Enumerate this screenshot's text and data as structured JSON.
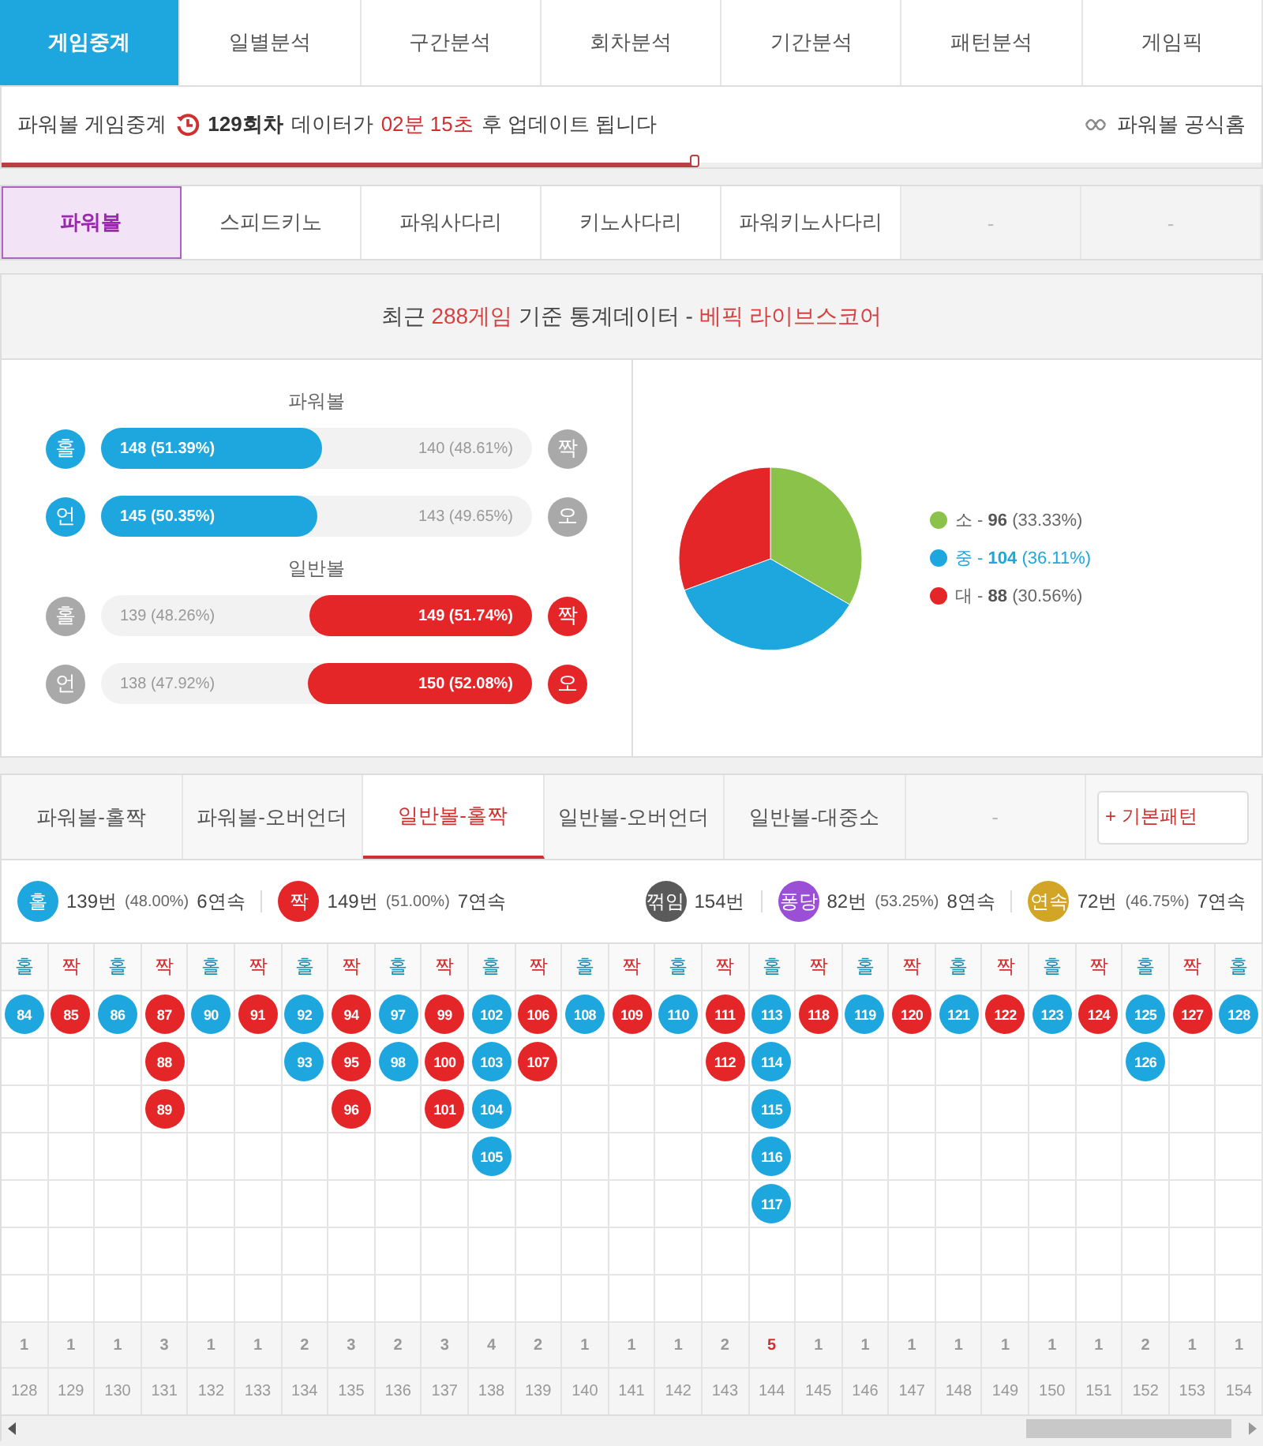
{
  "top_tabs": [
    {
      "label": "게임중계",
      "selected": true
    },
    {
      "label": "일별분석",
      "selected": false
    },
    {
      "label": "구간분석",
      "selected": false
    },
    {
      "label": "회차분석",
      "selected": false
    },
    {
      "label": "기간분석",
      "selected": false
    },
    {
      "label": "패턴분석",
      "selected": false
    },
    {
      "label": "게임픽",
      "selected": false
    }
  ],
  "info_bar": {
    "game": "파워볼 게임중계",
    "round": "129회차",
    "prefix": "데이터가",
    "countdown": "02분 15초",
    "suffix": "후 업데이트 됩니다",
    "progress": {
      "level": 0.55
    },
    "link": "파워볼 공식홈"
  },
  "game_tabs": [
    {
      "label": "파워볼",
      "selected": true,
      "disabled": false
    },
    {
      "label": "스피드키노",
      "selected": false,
      "disabled": false
    },
    {
      "label": "파워사다리",
      "selected": false,
      "disabled": false
    },
    {
      "label": "키노사다리",
      "selected": false,
      "disabled": false
    },
    {
      "label": "파워키노사다리",
      "selected": false,
      "disabled": false
    },
    {
      "label": "-",
      "selected": false,
      "disabled": true
    },
    {
      "label": "-",
      "selected": false,
      "disabled": true
    }
  ],
  "heading": [
    {
      "text": "최근 ",
      "accent": false
    },
    {
      "text": "288게임",
      "accent": true
    },
    {
      "text": " 기준 통계데이터 - ",
      "accent": false
    },
    {
      "text": "베픽 라이브스코어",
      "accent": true
    }
  ],
  "stats": {
    "groups": [
      {
        "title": "파워볼",
        "rows": [
          {
            "left_label": "홀",
            "left_text": "148 (51.39%)",
            "right_text": "140 (48.61%)",
            "right_label": "짝",
            "level": 0.5139
          },
          {
            "left_label": "언",
            "left_text": "145 (50.35%)",
            "right_text": "143 (49.65%)",
            "right_label": "오",
            "level": 0.5035
          }
        ]
      },
      {
        "title": "일반볼",
        "rows": [
          {
            "left_label": "홀",
            "left_text": "139 (48.26%)",
            "right_text": "149 (51.74%)",
            "right_label": "짝",
            "level": 0.4826
          },
          {
            "left_label": "언",
            "left_text": "138 (47.92%)",
            "right_text": "150 (52.08%)",
            "right_label": "오",
            "level": 0.4792
          }
        ]
      }
    ]
  },
  "breakdown": {
    "chart_data": {
      "type": "pie",
      "categories": [
        "소",
        "중",
        "대"
      ],
      "values": [
        33.33,
        36.11,
        30.56
      ]
    },
    "legend": [
      {
        "dash": "-",
        "count": "96",
        "pct": "(33.33%)",
        "color": "#8bc34a",
        "highlight": false
      },
      {
        "dash": "-",
        "count": "104",
        "pct": "(36.11%)",
        "color": "#1ea6de",
        "highlight": true
      },
      {
        "dash": "-",
        "count": "88",
        "pct": "(30.56%)",
        "color": "#e52628",
        "highlight": false
      }
    ]
  },
  "pattern_tabs": [
    {
      "label": "파워볼-홀짝",
      "selected": false,
      "disabled": false
    },
    {
      "label": "파워볼-오버언더",
      "selected": false,
      "disabled": false
    },
    {
      "label": "일반볼-홀짝",
      "selected": true,
      "disabled": false
    },
    {
      "label": "일반볼-오버언더",
      "selected": false,
      "disabled": false
    },
    {
      "label": "일반볼-대중소",
      "selected": false,
      "disabled": false
    },
    {
      "label": "-",
      "selected": false,
      "disabled": true
    }
  ],
  "pattern_button": "+ 기본패턴",
  "summary": {
    "left": [
      {
        "badge": "홀",
        "color": "#1ea6de",
        "count": "139번",
        "pct": "(48.00%)",
        "streak": "6연속"
      },
      {
        "badge": "짝",
        "color": "#e52628",
        "count": "149번",
        "pct": "(51.00%)",
        "streak": "7연속"
      }
    ],
    "right": [
      {
        "badge": "꺾임",
        "color": "#5a5a5a",
        "count": "154번"
      },
      {
        "badge": "퐁당",
        "color": "#9b4fd6",
        "count": "82번",
        "pct": "(53.25%)",
        "streak": "8연속"
      },
      {
        "badge": "연속",
        "color": "#d3a526",
        "count": "72번",
        "pct": "(46.75%)",
        "streak": "7연속"
      }
    ]
  },
  "grid": {
    "columns": [
      {
        "label": "홀",
        "kind": "odd",
        "balls": [
          "84"
        ],
        "count": "1",
        "round": "128",
        "highlight": false
      },
      {
        "label": "짝",
        "kind": "even",
        "balls": [
          "85"
        ],
        "count": "1",
        "round": "129",
        "highlight": false
      },
      {
        "label": "홀",
        "kind": "odd",
        "balls": [
          "86"
        ],
        "count": "1",
        "round": "130",
        "highlight": false
      },
      {
        "label": "짝",
        "kind": "even",
        "balls": [
          "87",
          "88",
          "89"
        ],
        "count": "3",
        "round": "131",
        "highlight": false
      },
      {
        "label": "홀",
        "kind": "odd",
        "balls": [
          "90"
        ],
        "count": "1",
        "round": "132",
        "highlight": false
      },
      {
        "label": "짝",
        "kind": "even",
        "balls": [
          "91"
        ],
        "count": "1",
        "round": "133",
        "highlight": false
      },
      {
        "label": "홀",
        "kind": "odd",
        "balls": [
          "92",
          "93"
        ],
        "count": "2",
        "round": "134",
        "highlight": false
      },
      {
        "label": "짝",
        "kind": "even",
        "balls": [
          "94",
          "95",
          "96"
        ],
        "count": "3",
        "round": "135",
        "highlight": false
      },
      {
        "label": "홀",
        "kind": "odd",
        "balls": [
          "97",
          "98"
        ],
        "count": "2",
        "round": "136",
        "highlight": false
      },
      {
        "label": "짝",
        "kind": "even",
        "balls": [
          "99",
          "100",
          "101"
        ],
        "count": "3",
        "round": "137",
        "highlight": false
      },
      {
        "label": "홀",
        "kind": "odd",
        "balls": [
          "102",
          "103",
          "104",
          "105"
        ],
        "count": "4",
        "round": "138",
        "highlight": false
      },
      {
        "label": "짝",
        "kind": "even",
        "balls": [
          "106",
          "107"
        ],
        "count": "2",
        "round": "139",
        "highlight": false
      },
      {
        "label": "홀",
        "kind": "odd",
        "balls": [
          "108"
        ],
        "count": "1",
        "round": "140",
        "highlight": false
      },
      {
        "label": "짝",
        "kind": "even",
        "balls": [
          "109"
        ],
        "count": "1",
        "round": "141",
        "highlight": false
      },
      {
        "label": "홀",
        "kind": "odd",
        "balls": [
          "110"
        ],
        "count": "1",
        "round": "142",
        "highlight": false
      },
      {
        "label": "짝",
        "kind": "even",
        "balls": [
          "111",
          "112"
        ],
        "count": "2",
        "round": "143",
        "highlight": false
      },
      {
        "label": "홀",
        "kind": "odd",
        "balls": [
          "113",
          "114",
          "115",
          "116",
          "117"
        ],
        "count": "5",
        "round": "144",
        "highlight": true
      },
      {
        "label": "짝",
        "kind": "even",
        "balls": [
          "118"
        ],
        "count": "1",
        "round": "145",
        "highlight": false
      },
      {
        "label": "홀",
        "kind": "odd",
        "balls": [
          "119"
        ],
        "count": "1",
        "round": "146",
        "highlight": false
      },
      {
        "label": "짝",
        "kind": "even",
        "balls": [
          "120"
        ],
        "count": "1",
        "round": "147",
        "highlight": false
      },
      {
        "label": "홀",
        "kind": "odd",
        "balls": [
          "121"
        ],
        "count": "1",
        "round": "148",
        "highlight": false
      },
      {
        "label": "짝",
        "kind": "even",
        "balls": [
          "122"
        ],
        "count": "1",
        "round": "149",
        "highlight": false
      },
      {
        "label": "홀",
        "kind": "odd",
        "balls": [
          "123"
        ],
        "count": "1",
        "round": "150",
        "highlight": false
      },
      {
        "label": "짝",
        "kind": "even",
        "balls": [
          "124"
        ],
        "count": "1",
        "round": "151",
        "highlight": false
      },
      {
        "label": "홀",
        "kind": "odd",
        "balls": [
          "125",
          "126"
        ],
        "count": "2",
        "round": "152",
        "highlight": false
      },
      {
        "label": "짝",
        "kind": "even",
        "balls": [
          "127"
        ],
        "count": "1",
        "round": "153",
        "highlight": false
      },
      {
        "label": "홀",
        "kind": "odd",
        "balls": [
          "128"
        ],
        "count": "1",
        "round": "154",
        "highlight": false
      }
    ]
  }
}
